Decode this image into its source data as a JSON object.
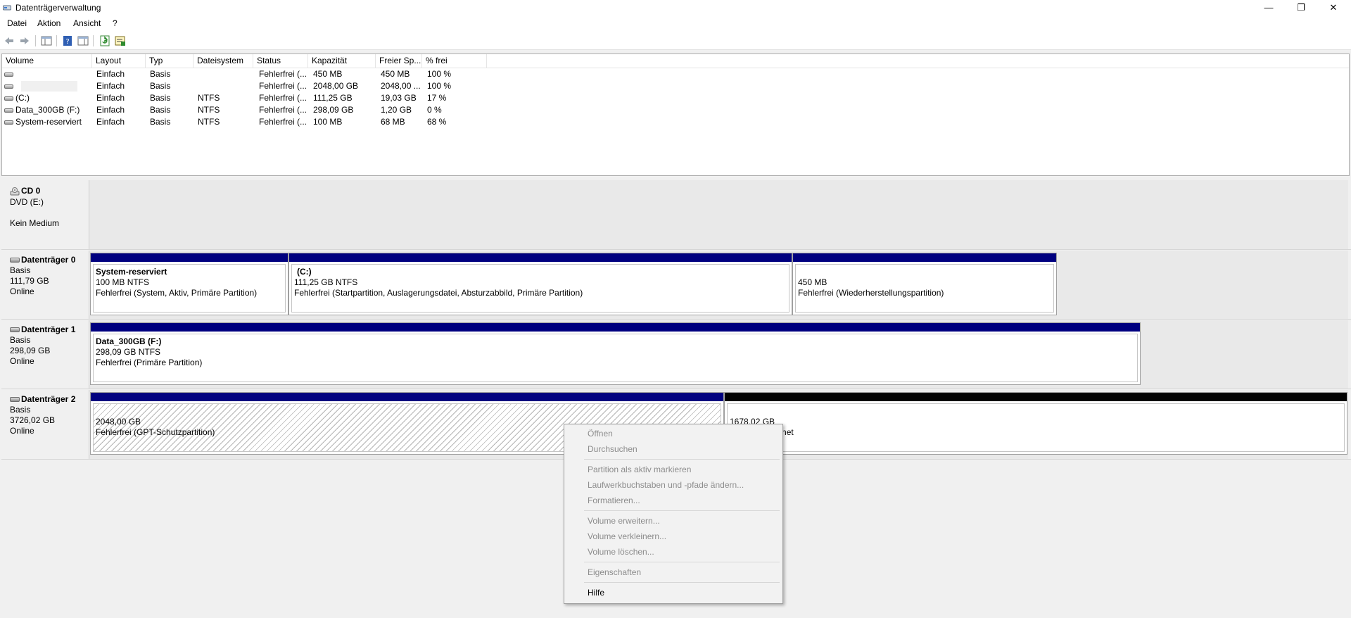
{
  "window": {
    "title": "Datenträgerverwaltung",
    "minimize": "—",
    "maximize": "❐",
    "close": "✕"
  },
  "menu": [
    "Datei",
    "Aktion",
    "Ansicht",
    "?"
  ],
  "toolbar": {
    "icons": [
      "back-icon",
      "forward-icon",
      "console-tree-icon",
      "help-icon",
      "properties-view-icon",
      "refresh-icon",
      "export-list-icon"
    ]
  },
  "volume_list": {
    "columns": [
      "Volume",
      "Layout",
      "Typ",
      "Dateisystem",
      "Status",
      "Kapazität",
      "Freier Sp...",
      "% frei"
    ],
    "rows": [
      {
        "volume": "",
        "layout": "Einfach",
        "typ": "Basis",
        "fs": "",
        "status": "Fehlerfrei (...",
        "kapazitaet": "450 MB",
        "frei": "450 MB",
        "pct": "100 %"
      },
      {
        "volume": "",
        "layout": "Einfach",
        "typ": "Basis",
        "fs": "",
        "status": "Fehlerfrei (...",
        "kapazitaet": "2048,00 GB",
        "frei": "2048,00 ...",
        "pct": "100 %"
      },
      {
        "volume": "(C:)",
        "layout": "Einfach",
        "typ": "Basis",
        "fs": "NTFS",
        "status": "Fehlerfrei (...",
        "kapazitaet": "111,25 GB",
        "frei": "19,03 GB",
        "pct": "17 %"
      },
      {
        "volume": "Data_300GB (F:)",
        "layout": "Einfach",
        "typ": "Basis",
        "fs": "NTFS",
        "status": "Fehlerfrei (...",
        "kapazitaet": "298,09 GB",
        "frei": "1,20 GB",
        "pct": "0 %"
      },
      {
        "volume": "System-reserviert",
        "layout": "Einfach",
        "typ": "Basis",
        "fs": "NTFS",
        "status": "Fehlerfrei (...",
        "kapazitaet": "100 MB",
        "frei": "68 MB",
        "pct": "68 %"
      }
    ]
  },
  "disks": {
    "cd0": {
      "name": "CD 0",
      "line1": "DVD (E:)",
      "line2": "Kein Medium"
    },
    "disk0": {
      "name": "Datenträger 0",
      "type": "Basis",
      "size": "111,79 GB",
      "state": "Online",
      "partitions": [
        {
          "title": "System-reserviert",
          "size": "100 MB NTFS",
          "status": "Fehlerfrei (System, Aktiv, Primäre Partition)"
        },
        {
          "title": "(C:)",
          "size": "111,25 GB NTFS",
          "status": "Fehlerfrei (Startpartition, Auslagerungsdatei, Absturzabbild, Primäre Partition)"
        },
        {
          "title": "",
          "size": "450 MB",
          "status": "Fehlerfrei (Wiederherstellungspartition)"
        }
      ]
    },
    "disk1": {
      "name": "Datenträger 1",
      "type": "Basis",
      "size": "298,09 GB",
      "state": "Online",
      "partitions": [
        {
          "title": "Data_300GB  (F:)",
          "size": "298,09 GB NTFS",
          "status": "Fehlerfrei (Primäre Partition)"
        }
      ]
    },
    "disk2": {
      "name": "Datenträger 2",
      "type": "Basis",
      "size": "3726,02 GB",
      "state": "Online",
      "partitions": [
        {
          "size": "2048,00 GB",
          "status": "Fehlerfrei (GPT-Schutzpartition)"
        },
        {
          "size": "1678,02 GB",
          "status": "Nicht zugeordnet"
        }
      ]
    }
  },
  "context_menu": {
    "items": [
      {
        "label": "Öffnen",
        "enabled": false
      },
      {
        "label": "Durchsuchen",
        "enabled": false
      },
      {
        "label": "Partition als aktiv markieren",
        "enabled": false
      },
      {
        "label": "Laufwerkbuchstaben und -pfade ändern...",
        "enabled": false
      },
      {
        "label": "Formatieren...",
        "enabled": false
      },
      {
        "label": "Volume erweitern...",
        "enabled": false
      },
      {
        "label": "Volume verkleinern...",
        "enabled": false
      },
      {
        "label": "Volume löschen...",
        "enabled": false
      },
      {
        "label": "Eigenschaften",
        "enabled": false
      },
      {
        "label": "Hilfe",
        "enabled": true
      }
    ]
  }
}
